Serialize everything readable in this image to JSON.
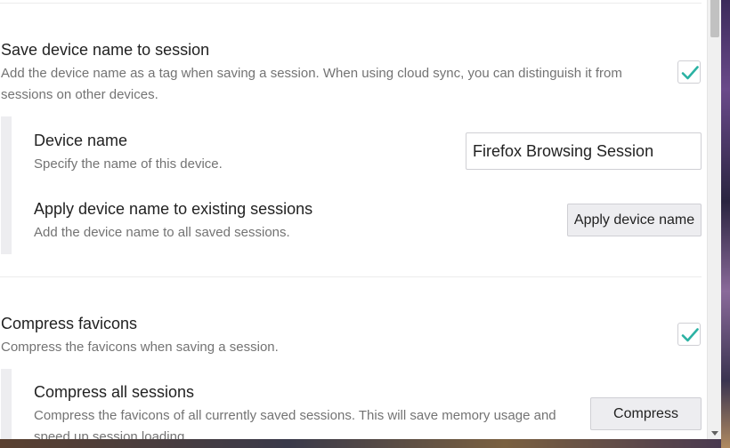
{
  "settings": {
    "save_device_name": {
      "title": "Save device name to session",
      "description": "Add the device name as a tag when saving a session. When using cloud sync, you can distinguish it from sessions on other devices.",
      "checked": true
    },
    "device_name": {
      "title": "Device name",
      "description": "Specify the name of this device.",
      "value": "Firefox Browsing Session"
    },
    "apply_device_name": {
      "title": "Apply device name to existing sessions",
      "description": "Add the device name to all saved sessions.",
      "button_label": "Apply device name"
    },
    "compress_favicons": {
      "title": "Compress favicons",
      "description": "Compress the favicons when saving a session.",
      "checked": true
    },
    "compress_all": {
      "title": "Compress all sessions",
      "description": "Compress the favicons of all currently saved sessions. This will save memory usage and speed up session loading.",
      "button_label": "Compress"
    }
  },
  "icons": {
    "checkmark": "checkmark-icon",
    "scroll_down": "chevron-down-icon"
  },
  "colors": {
    "accent": "#2bb2a3"
  }
}
